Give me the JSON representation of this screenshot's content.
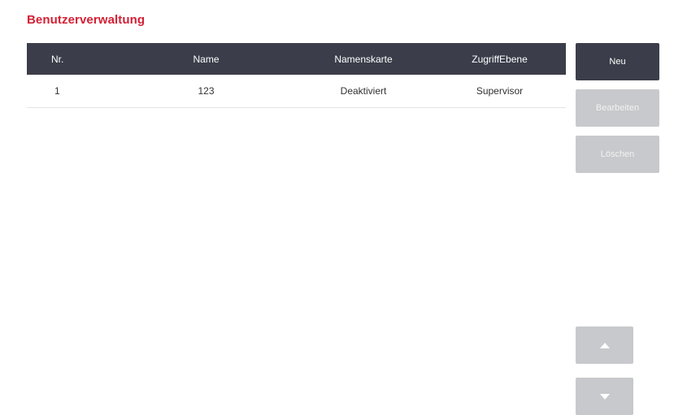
{
  "page": {
    "title": "Benutzerverwaltung"
  },
  "table": {
    "columns": [
      "Nr.",
      "Name",
      "Namenskarte",
      "ZugriffEbene"
    ],
    "rows": [
      [
        "1",
        "123",
        "Deaktiviert",
        "Supervisor"
      ]
    ]
  },
  "actions": {
    "new_label": "Neu",
    "edit_label": "Bearbeiten",
    "delete_label": "Löschen",
    "edit_enabled": false,
    "delete_enabled": false
  },
  "scroll": {
    "up_icon": "triangle-up-icon",
    "down_icon": "triangle-down-icon"
  },
  "colors": {
    "title": "#d32035",
    "header_bg": "#3b3e4a",
    "disabled_bg": "#c8c9cc"
  }
}
